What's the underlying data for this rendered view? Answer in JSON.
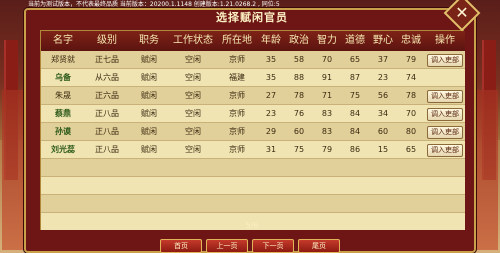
{
  "debug_line": "当前为测试版本，不代表最终品质   当前版本：20200.1.1148  创建版本:1.21.0268.2 , 同位:5",
  "dialog": {
    "title": "选择赋闲官员",
    "close_icon": "close-x-icon"
  },
  "table": {
    "headers": [
      "名字",
      "级别",
      "职务",
      "工作状态",
      "所在地",
      "年龄",
      "政治",
      "智力",
      "道德",
      "野心",
      "忠诚",
      "操作"
    ],
    "rows": [
      {
        "name": "郑贤就",
        "rank": "正七品",
        "post": "赋闲",
        "status": "空闲",
        "location": "京师",
        "age": "35",
        "politics": "58",
        "intellect": "70",
        "morality": "65",
        "ambition": "37",
        "loyalty": "79",
        "action": "调入吏部"
      },
      {
        "name": "乌备",
        "rank": "从六品",
        "post": "赋闲",
        "status": "空闲",
        "location": "福建",
        "age": "35",
        "politics": "88",
        "intellect": "91",
        "morality": "87",
        "ambition": "23",
        "loyalty": "74",
        "action": ""
      },
      {
        "name": "朱晟",
        "rank": "正六品",
        "post": "赋闲",
        "status": "空闲",
        "location": "京师",
        "age": "27",
        "politics": "78",
        "intellect": "71",
        "morality": "75",
        "ambition": "56",
        "loyalty": "78",
        "action": "调入吏部"
      },
      {
        "name": "蔡鼎",
        "rank": "正八品",
        "post": "赋闲",
        "status": "空闲",
        "location": "京师",
        "age": "23",
        "politics": "76",
        "intellect": "83",
        "morality": "84",
        "ambition": "34",
        "loyalty": "70",
        "action": "调入吏部"
      },
      {
        "name": "孙谟",
        "rank": "正八品",
        "post": "赋闲",
        "status": "空闲",
        "location": "京师",
        "age": "29",
        "politics": "60",
        "intellect": "83",
        "morality": "84",
        "ambition": "60",
        "loyalty": "80",
        "action": "调入吏部"
      },
      {
        "name": "刘光蕊",
        "rank": "正八品",
        "post": "赋闲",
        "status": "空闲",
        "location": "京师",
        "age": "31",
        "politics": "75",
        "intellect": "79",
        "morality": "86",
        "ambition": "15",
        "loyalty": "65",
        "action": "调入吏部"
      }
    ]
  },
  "pager": {
    "text": "5/6",
    "first": "首页",
    "prev": "上一页",
    "next": "下一页",
    "last": "尾页"
  }
}
